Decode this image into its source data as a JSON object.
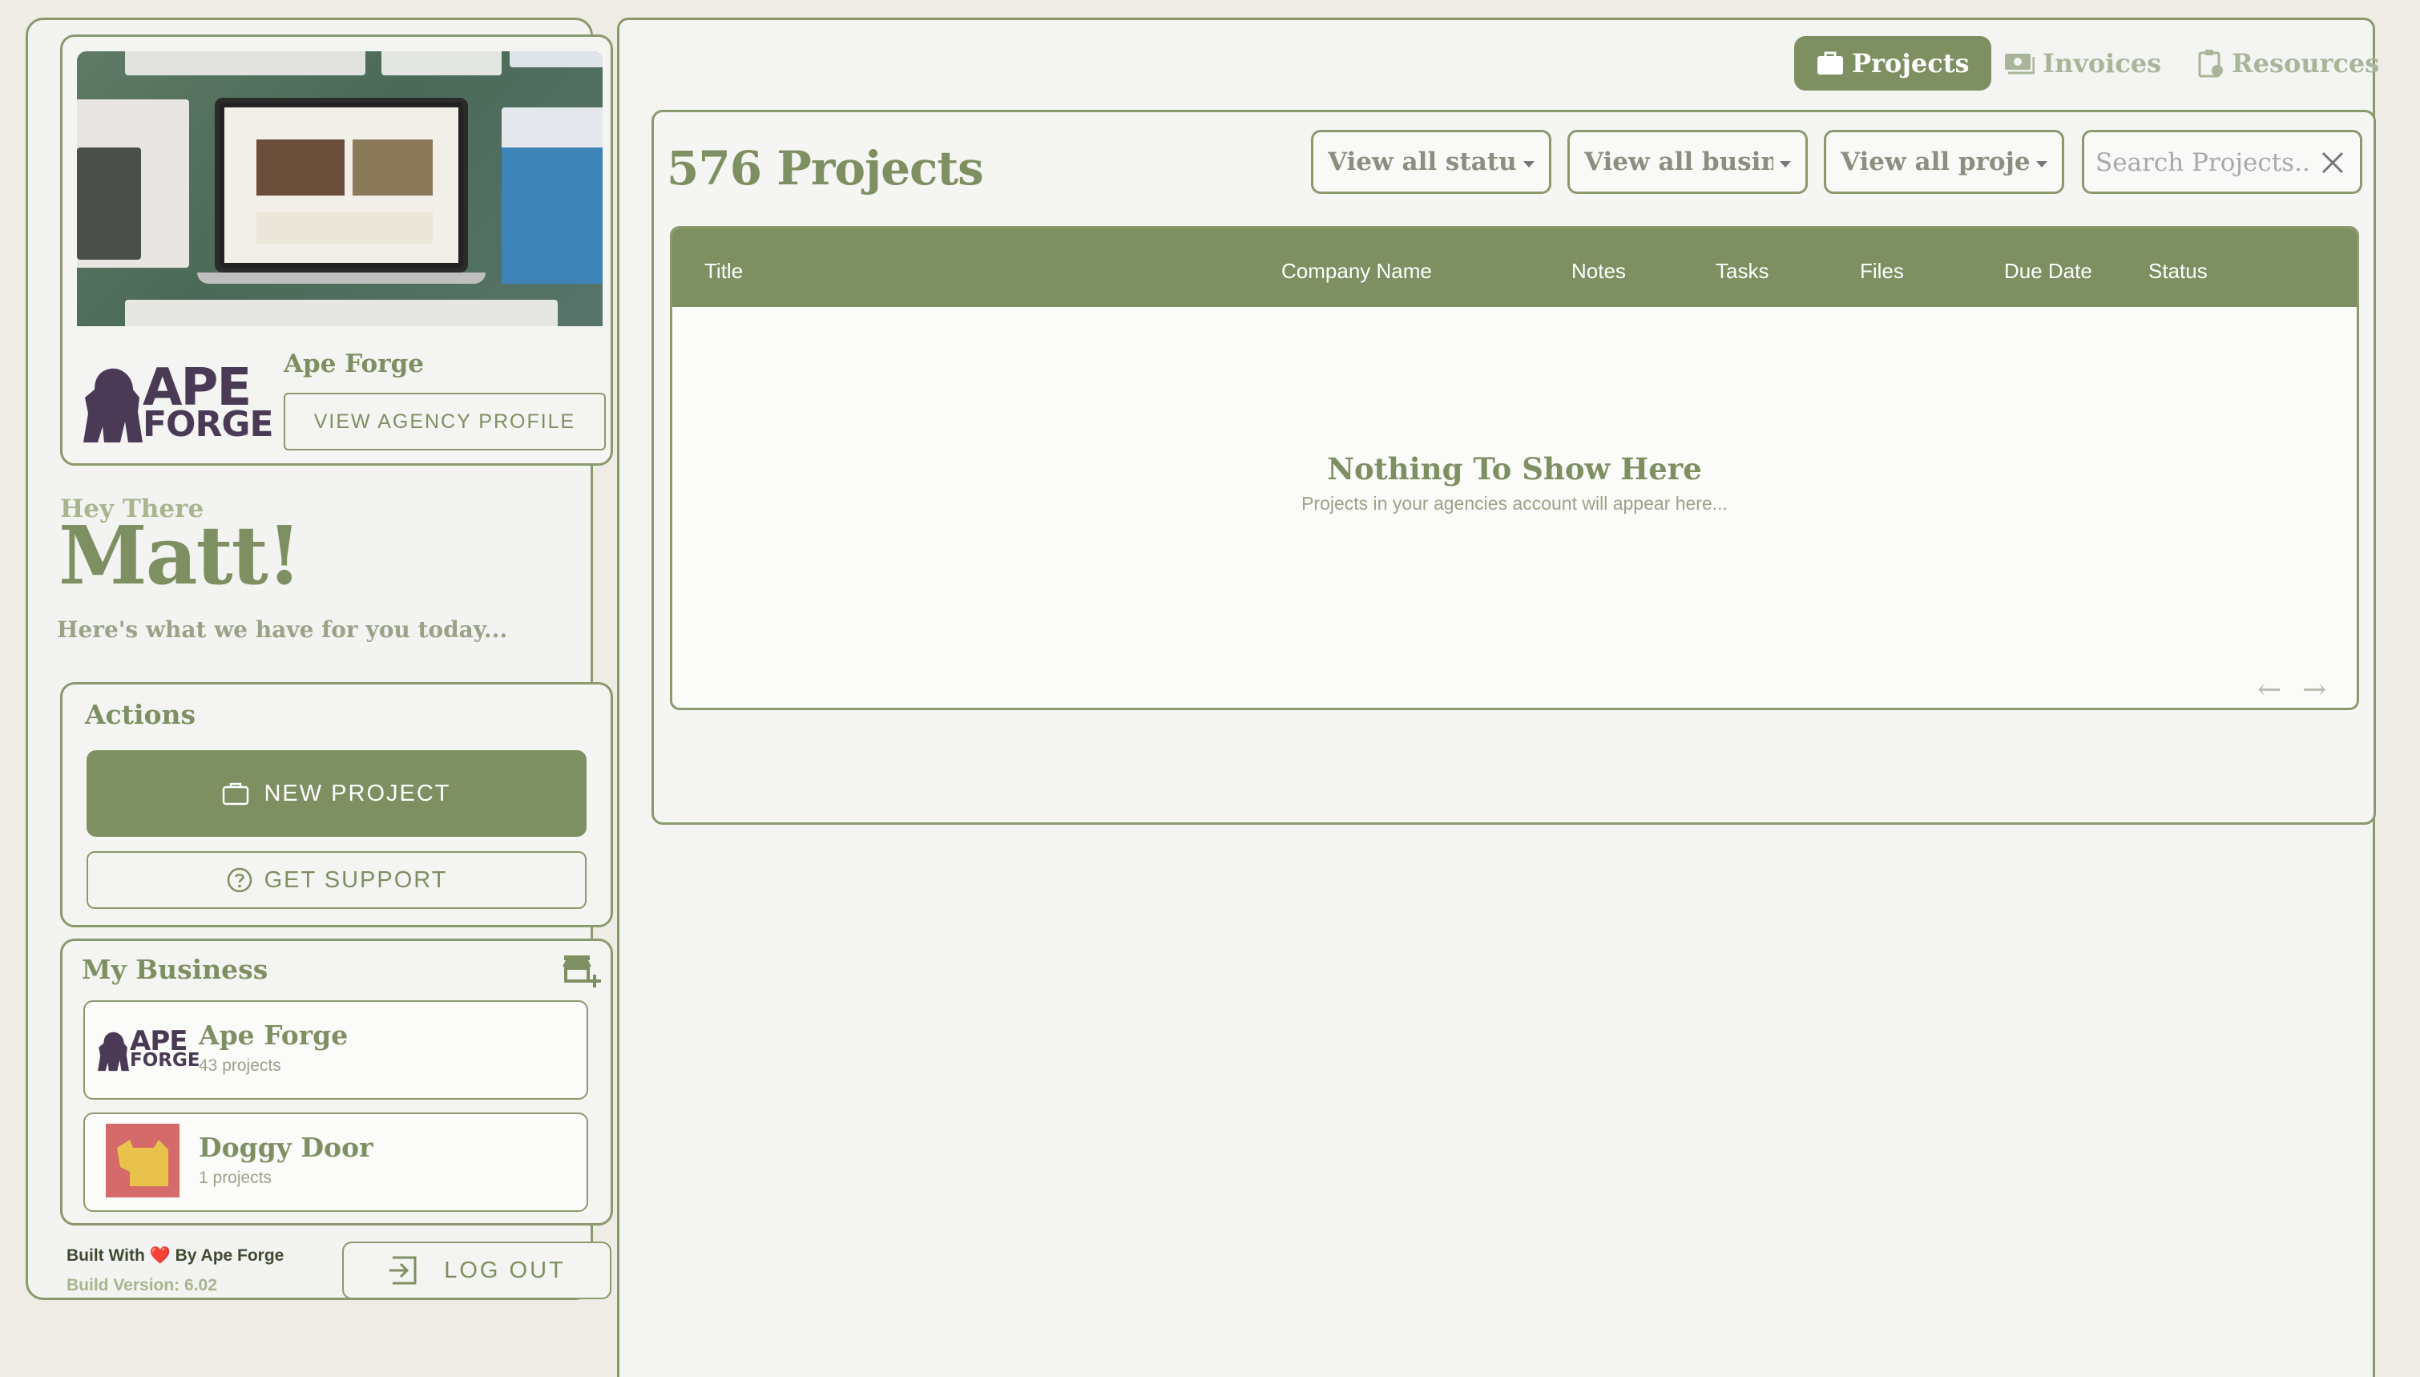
{
  "sidebar": {
    "agency": {
      "name": "Ape Forge",
      "logo_top": "APE",
      "logo_bottom": "FORGE",
      "view_profile_label": "VIEW AGENCY PROFILE"
    },
    "greeting": {
      "small": "Hey There",
      "name": "Matt!",
      "subtitle": "Here's what we have for you today..."
    },
    "actions": {
      "title": "Actions",
      "new_project_label": "NEW PROJECT",
      "get_support_label": "GET SUPPORT"
    },
    "business": {
      "title": "My Business",
      "items": [
        {
          "name": "Ape Forge",
          "count": "43 projects",
          "logo_top": "APE",
          "logo_bottom": "FORGE"
        },
        {
          "name": "Doggy Door",
          "count": "1 projects"
        }
      ]
    },
    "footer": {
      "built_prefix": "Built With",
      "heart": "❤️",
      "built_suffix": "By Ape Forge",
      "version": "Build Version: 6.02",
      "logout_label": "LOG OUT"
    }
  },
  "nav": {
    "tabs": [
      {
        "label": "Projects",
        "active": true,
        "icon": "briefcase-icon"
      },
      {
        "label": "Invoices",
        "active": false,
        "icon": "cash-icon"
      },
      {
        "label": "Resources",
        "active": false,
        "icon": "clipboard-icon"
      }
    ]
  },
  "projects": {
    "title": "576 Projects",
    "filters": [
      "View all statuses",
      "View all businesses",
      "View all projects"
    ],
    "search_placeholder": "Search Projects...",
    "columns": [
      "Title",
      "Company Name",
      "Notes",
      "Tasks",
      "Files",
      "Due Date",
      "Status"
    ],
    "empty_title": "Nothing To Show Here",
    "empty_subtitle": "Projects in your agencies account will appear here...",
    "pager_prev": "←",
    "pager_next": "→"
  },
  "colors": {
    "accent": "#7e8f61",
    "background": "#efece6",
    "logo": "#4a3a55"
  }
}
